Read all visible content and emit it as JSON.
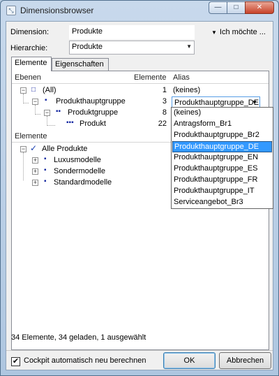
{
  "window": {
    "title": "Dimensionsbrowser",
    "minimize": "—",
    "maximize": "□",
    "close": "✕"
  },
  "form": {
    "dimension_label": "Dimension:",
    "dimension_value": "Produkte",
    "hierarchy_label": "Hierarchie:",
    "hierarchy_value": "Produkte",
    "ich_moechte": "Ich möchte ..."
  },
  "tabs": [
    {
      "label": "Elemente",
      "active": true
    },
    {
      "label": "Eigenschaften",
      "active": false
    }
  ],
  "levels": {
    "header_ebenen": "Ebenen",
    "header_elemente": "Elemente",
    "header_alias": "Alias",
    "rows": [
      {
        "label": "(All)",
        "count": "1",
        "alias": "(keines)"
      },
      {
        "label": "Produkthauptgruppe",
        "count": "3",
        "alias": "Produkthauptgruppe_DE"
      },
      {
        "label": "Produktgruppe",
        "count": "8",
        "alias": ""
      },
      {
        "label": "Produkt",
        "count": "22",
        "alias": ""
      }
    ]
  },
  "alias_dropdown": {
    "selected": "Produkthauptgruppe_DE",
    "options": [
      "(keines)",
      "Antragsform_Br1",
      "Produkthauptgruppe_Br2",
      "Produkthauptgruppe_DE",
      "Produkthauptgruppe_EN",
      "Produkthauptgruppe_ES",
      "Produkthauptgruppe_FR",
      "Produkthauptgruppe_IT",
      "Serviceangebot_Br3"
    ]
  },
  "elements": {
    "header": "Elemente",
    "root": "Alle Produkte",
    "children": [
      "Luxusmodelle",
      "Sondermodelle",
      "Standardmodelle"
    ]
  },
  "status": "34 Elemente, 34 geladen, 1 ausgewählt",
  "footer": {
    "checkbox_label": "Cockpit automatisch neu berechnen",
    "checkbox_checked": true,
    "ok": "OK",
    "cancel": "Abbrechen"
  }
}
